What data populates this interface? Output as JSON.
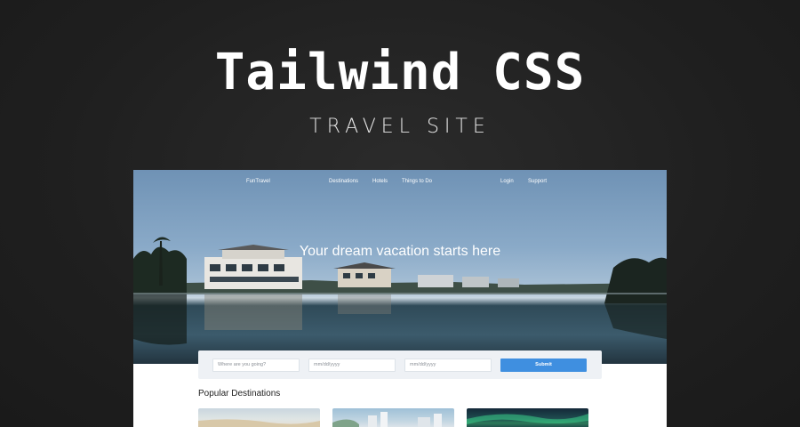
{
  "banner": {
    "title": "Tailwind CSS",
    "subtitle": "TRAVEL SITE"
  },
  "site": {
    "nav": {
      "brand": "FunTravel",
      "links": [
        "Destinations",
        "Hotels",
        "Things to Do"
      ],
      "login": "Login",
      "support": "Support"
    },
    "hero": {
      "heading": "Your dream vacation starts here"
    },
    "search": {
      "destination_placeholder": "Where are you going?",
      "checkin_value": "mm/dd/yyyy",
      "checkout_value": "mm/dd/yyyy",
      "submit_label": "Submit"
    },
    "popular": {
      "heading": "Popular Destinations"
    }
  },
  "colors": {
    "background": "#1f1f1f",
    "accent": "#3f8fe0"
  }
}
